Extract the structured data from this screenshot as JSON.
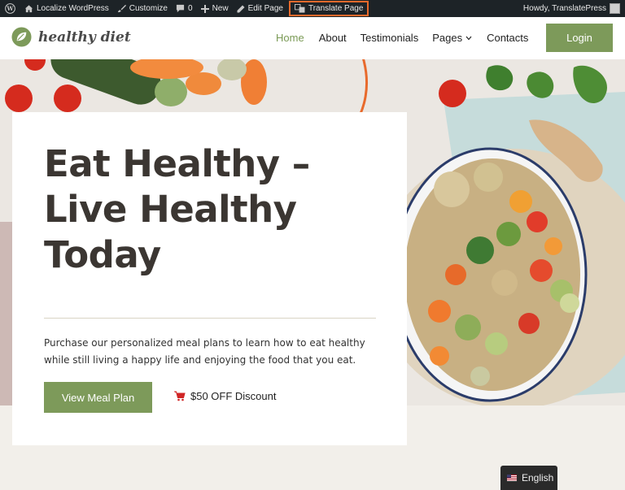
{
  "admin_bar": {
    "site_name": "Localize WordPress",
    "customize": "Customize",
    "comments_count": "0",
    "new": "New",
    "edit_page": "Edit Page",
    "translate_page": "Translate Page",
    "howdy": "Howdy, TranslatePress"
  },
  "header": {
    "logo_text": "healthy diet",
    "nav": {
      "home": "Home",
      "about": "About",
      "testimonials": "Testimonials",
      "pages": "Pages",
      "contacts": "Contacts"
    },
    "login": "Login"
  },
  "hero": {
    "title_line1": "Eat Healthy –",
    "title_line2": "Live Healthy",
    "title_line3": "Today",
    "description": "Purchase our personalized meal plans to learn how to eat healthy while still living a happy life and enjoying the food that you eat.",
    "cta": "View Meal Plan",
    "discount": "$50 OFF Discount"
  },
  "language_switcher": {
    "label": "English"
  },
  "colors": {
    "brand_green": "#7d9a5a",
    "annotation_orange": "#e86a2c",
    "admin_bar": "#1d2327"
  },
  "icons": [
    "wordpress-icon",
    "home-icon",
    "brush-icon",
    "comment-icon",
    "plus-icon",
    "pencil-icon",
    "translate-icon",
    "avatar-icon",
    "leaf-logo-icon",
    "chevron-down-icon",
    "cart-icon",
    "flag-icon"
  ]
}
